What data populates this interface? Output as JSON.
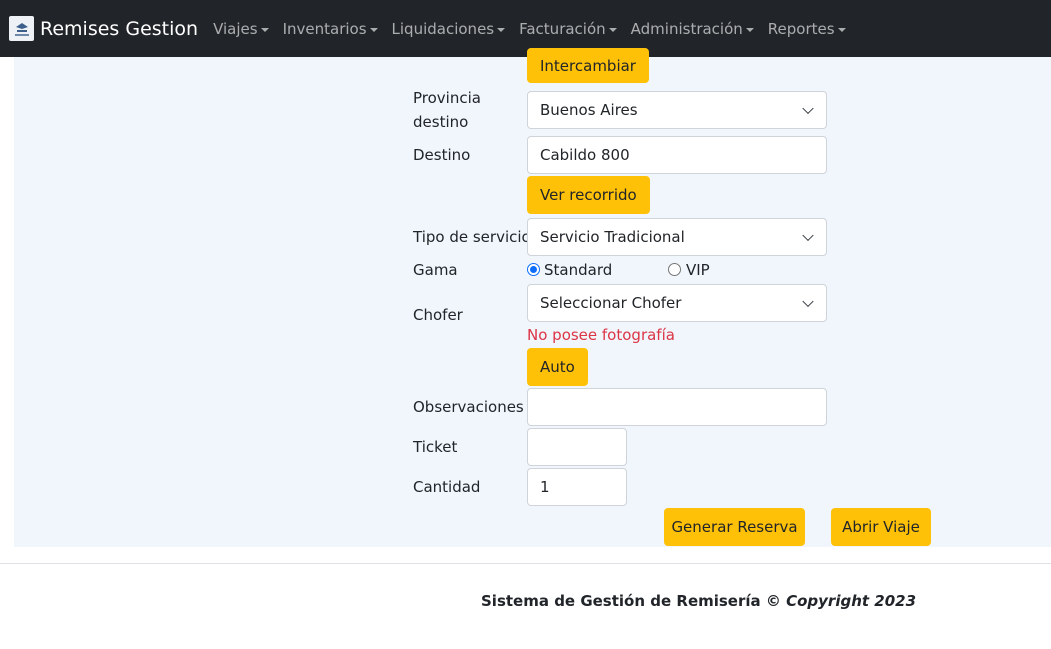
{
  "navbar": {
    "brand": "Remises Gestion",
    "brand_logo_icon": "remises-logo-icon",
    "menu": [
      {
        "label": "Viajes"
      },
      {
        "label": "Inventarios"
      },
      {
        "label": "Liquidaciones"
      },
      {
        "label": "Facturación"
      },
      {
        "label": "Administración"
      },
      {
        "label": "Reportes"
      }
    ]
  },
  "form": {
    "swap_button": "Intercambiar",
    "provincia_destino": {
      "label_line1": "Provincia",
      "label_line2": "destino",
      "value": "Buenos Aires"
    },
    "destino": {
      "label": "Destino",
      "value": "Cabildo 800"
    },
    "ver_recorrido_button": "Ver recorrido",
    "tipo_servicio": {
      "label": "Tipo de servicio",
      "value": "Servicio Tradicional"
    },
    "gama": {
      "label": "Gama",
      "options": [
        {
          "label": "Standard",
          "checked": true
        },
        {
          "label": "VIP",
          "checked": false
        }
      ]
    },
    "chofer": {
      "label": "Chofer",
      "value": "Seleccionar Chofer",
      "photo_message": "No posee fotografía"
    },
    "auto_button": "Auto",
    "observaciones": {
      "label": "Observaciones",
      "value": ""
    },
    "ticket": {
      "label": "Ticket",
      "value": ""
    },
    "cantidad": {
      "label": "Cantidad",
      "value": "1"
    },
    "generar_reserva_button": "Generar Reserva",
    "abrir_viaje_button": "Abrir Viaje"
  },
  "footer": {
    "text": "Sistema de Gestión de Remisería © ",
    "copyright": "Copyright 2023"
  },
  "colors": {
    "navbar_bg": "#212529",
    "content_bg": "#f0f6fc",
    "button_yellow": "#ffc107",
    "error_red": "#dc3545",
    "radio_blue": "#0d6efd"
  }
}
